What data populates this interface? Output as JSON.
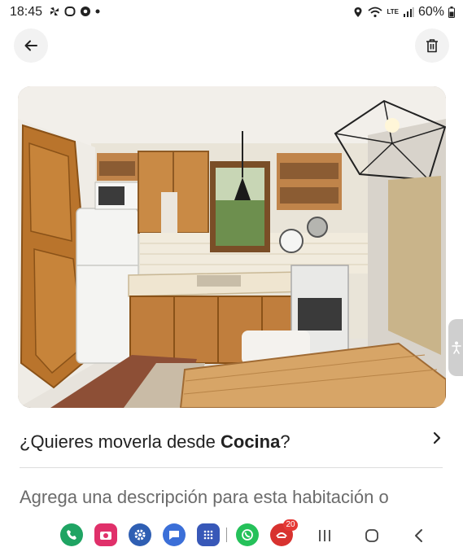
{
  "status_bar": {
    "time": "18:45",
    "network_label": "LTE",
    "battery": "60%",
    "left_icons": [
      "pinwheel-icon",
      "shield-icon",
      "chrome-icon",
      "dot-icon"
    ],
    "right_icons": [
      "location-icon",
      "wifi-icon",
      "signal-icon",
      "battery-icon"
    ]
  },
  "header": {
    "back_icon": "arrow-left-icon",
    "delete_icon": "trash-icon"
  },
  "photo": {
    "subject": "kitchen-photo"
  },
  "move_prompt": {
    "prefix": "¿Quieres moverla desde ",
    "room": "Cocina",
    "suffix": "?"
  },
  "description_placeholder": "Agrega una descripción para esta habitación o",
  "nav_bar": {
    "apps": [
      "phone-app-icon",
      "camera-app-icon",
      "settings-app-icon",
      "messages-app-icon",
      "app-drawer-icon",
      "whatsapp-app-icon",
      "sangoma-app-icon"
    ],
    "badge_count": "20",
    "controls": [
      "recents-button",
      "home-button",
      "back-button"
    ]
  },
  "colors": {
    "accent": "#222222",
    "placeholder": "#6b6b6b",
    "button_bg": "#f2f2f2"
  }
}
